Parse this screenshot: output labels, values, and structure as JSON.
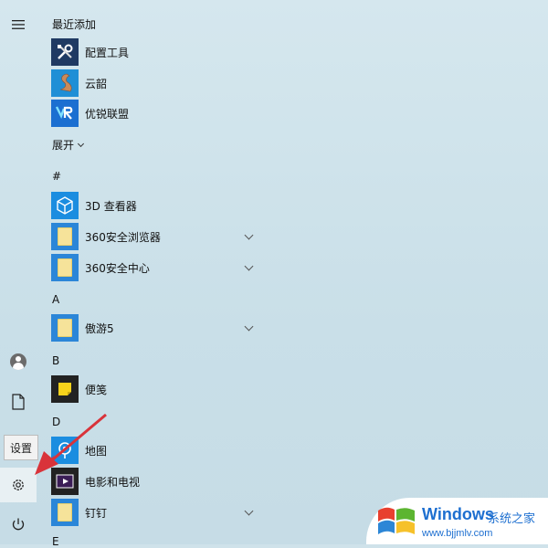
{
  "sections": {
    "recent": "最近添加",
    "hash": "#",
    "a": "A",
    "b": "B",
    "d": "D",
    "e": "E"
  },
  "expand_label": "展开",
  "apps": {
    "config_tool": "配置工具",
    "yunshao": "云韶",
    "youruilm": "优锐联盟",
    "viewer3d": "3D 查看器",
    "browser360": "360安全浏览器",
    "security360": "360安全中心",
    "maxthon": "傲游5",
    "sticky": "便笺",
    "maps": "地图",
    "movies": "电影和电视",
    "dingtalk": "钉钉"
  },
  "tooltip": "设置",
  "watermark": {
    "brand": "Windows",
    "sub": "系统之家",
    "url": "www.bjjmlv.com"
  },
  "colors": {
    "accent": "#1f8fd6",
    "arrow": "#d9333a"
  }
}
